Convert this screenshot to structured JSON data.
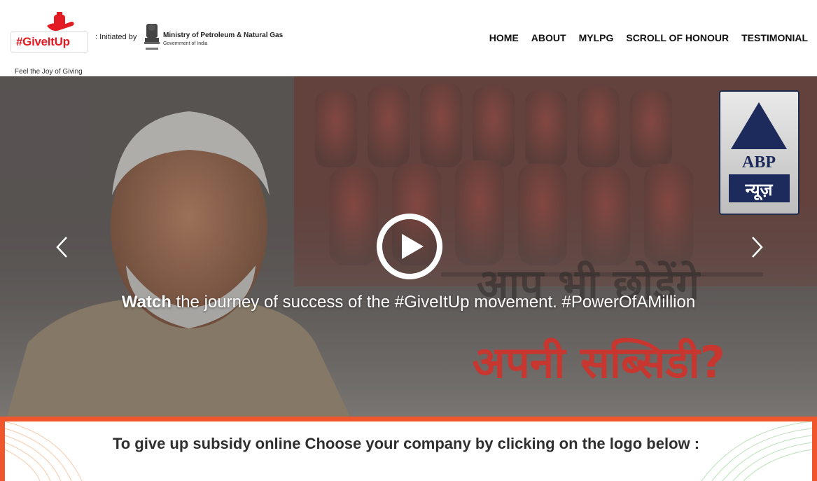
{
  "header": {
    "logo_text": "#GiveItUp",
    "logo_tagline": "Feel the Joy of Giving",
    "initiated_by": ": Initiated by",
    "ministry": "Ministry of Petroleum & Natural Gas",
    "government": "Government of India"
  },
  "nav": {
    "items": [
      "HOME",
      "ABOUT",
      "MYLPG",
      "SCROLL OF HONOUR",
      "TESTIMONIAL"
    ]
  },
  "hero": {
    "caption_bold": "Watch",
    "caption_rest": " the journey of success of the #GiveItUp movement. #PowerOfAMillion",
    "badge": "ABP",
    "badge_sub": "न्यूज़",
    "hindi_line1": "आप भी छोड़ेंगे",
    "hindi_line2": "अपनी सब्सिडी?"
  },
  "bottom": {
    "title": "To give up subsidy online Choose your company by clicking on the logo below :"
  },
  "colors": {
    "brand_red": "#e31b23",
    "accent_orange": "#f1552b"
  }
}
